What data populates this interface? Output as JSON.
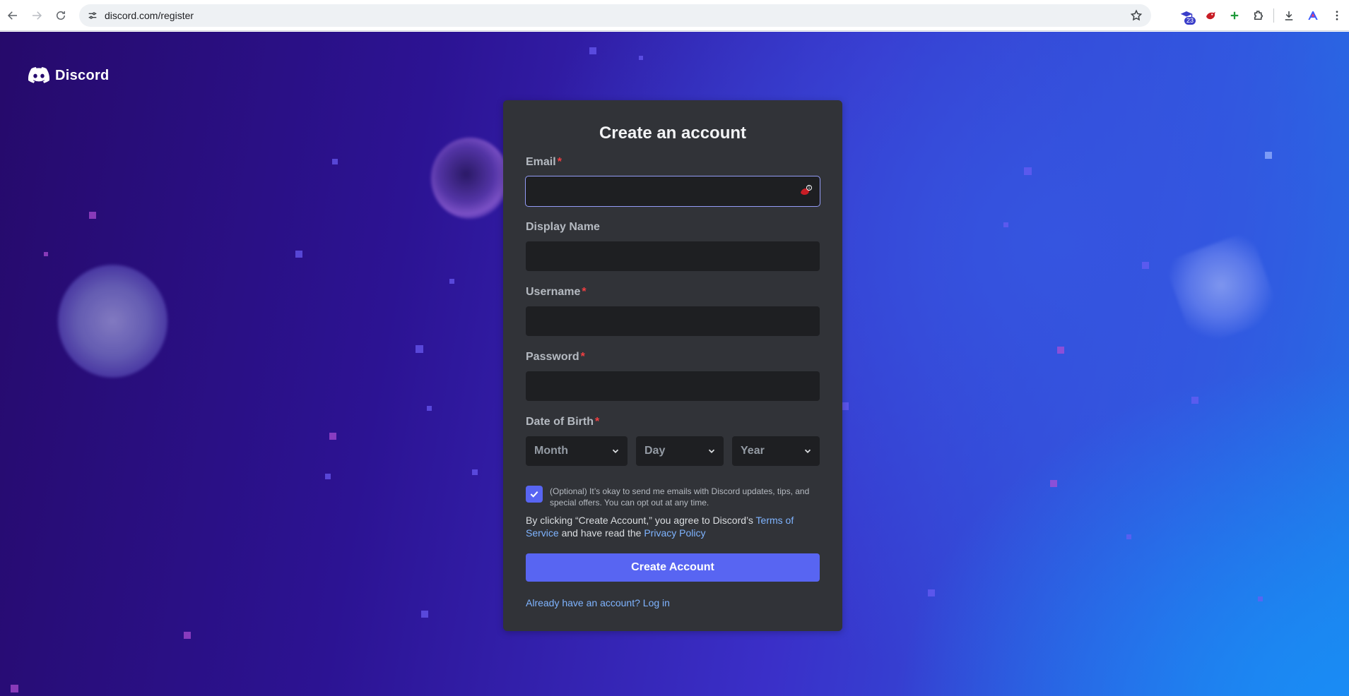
{
  "browser": {
    "url": "discord.com/register",
    "extension_badge": "23"
  },
  "brand": {
    "name": "Discord",
    "accent_color": "#5865f2"
  },
  "form": {
    "title": "Create an account",
    "required_marker": "*",
    "email": {
      "label": "Email",
      "value": ""
    },
    "display_name": {
      "label": "Display Name",
      "value": ""
    },
    "username": {
      "label": "Username",
      "value": ""
    },
    "password": {
      "label": "Password",
      "value": ""
    },
    "dob": {
      "label": "Date of Birth",
      "month_placeholder": "Month",
      "day_placeholder": "Day",
      "year_placeholder": "Year"
    },
    "optin": {
      "checked": true,
      "text": "(Optional) It’s okay to send me emails with Discord updates, tips, and special offers. You can opt out at any time."
    },
    "terms": {
      "prefix": "By clicking “Create Account,” you agree to Discord’s ",
      "tos_link": "Terms of Service",
      "middle": " and have read the ",
      "privacy_link": "Privacy Policy"
    },
    "submit_label": "Create Account",
    "login_link": "Already have an account? Log in"
  }
}
